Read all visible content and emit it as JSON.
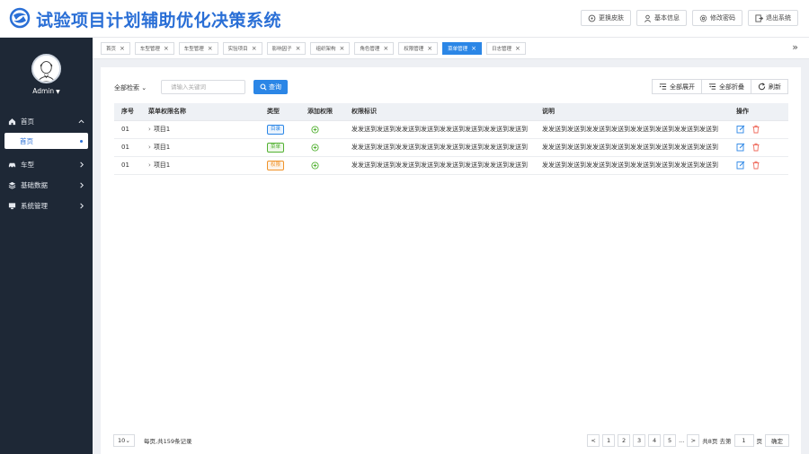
{
  "app": {
    "title": "试验项目计划辅助优化决策系统",
    "accent": "#2b86e6"
  },
  "header_buttons": [
    {
      "label": "更换皮肤",
      "icon": "skin-icon"
    },
    {
      "label": "基本信息",
      "icon": "user-icon"
    },
    {
      "label": "修改密码",
      "icon": "gear-icon"
    },
    {
      "label": "退出系统",
      "icon": "logout-icon"
    }
  ],
  "sidebar": {
    "user": "Admin",
    "items": [
      {
        "label": "首页",
        "icon": "home-icon"
      },
      {
        "label": "车型",
        "icon": "car-icon"
      },
      {
        "label": "基础数据",
        "icon": "data-icon"
      },
      {
        "label": "系统管理",
        "icon": "monitor-icon"
      }
    ],
    "sub_item": "首页"
  },
  "tabs": [
    {
      "label": "首页",
      "active": false
    },
    {
      "label": "车型管理",
      "active": false
    },
    {
      "label": "车型管理",
      "active": false
    },
    {
      "label": "实验项目",
      "active": false
    },
    {
      "label": "影响因子",
      "active": false
    },
    {
      "label": "组织架构",
      "active": false
    },
    {
      "label": "角色管理",
      "active": false
    },
    {
      "label": "权限管理",
      "active": false
    },
    {
      "label": "菜单管理",
      "active": true
    },
    {
      "label": "日志管理",
      "active": false
    }
  ],
  "toolbar": {
    "filter_label": "全部检索",
    "search_placeholder": "请输入关键词",
    "query_label": "查询",
    "expand_all": "全部展开",
    "collapse_all": "全部折叠",
    "refresh": "刷新"
  },
  "table": {
    "headers": [
      "序号",
      "菜单权限名称",
      "类型",
      "添加权限",
      "权限标识",
      "说明",
      "操作"
    ],
    "rows": [
      {
        "no": "01",
        "name": "项目1",
        "type": "目录",
        "type_color": "#2b86e6",
        "perm": "发发送到发送到发发送到发送到发发送到发送到发发送到发送到",
        "desc": "发发送到发送到发发送到发送到发发送到发送到发发送到发送到"
      },
      {
        "no": "01",
        "name": "项目1",
        "type": "菜单",
        "type_color": "#52b132",
        "perm": "发发送到发送到发发送到发送到发发送到发送到发发送到发送到",
        "desc": "发发送到发送到发发送到发送到发发送到发送到发发送到发送到"
      },
      {
        "no": "01",
        "name": "项目1",
        "type": "权限",
        "type_color": "#f0932a",
        "perm": "发发送到发送到发发送到发送到发发送到发送到发发送到发送到",
        "desc": "发发送到发送到发发送到发送到发发送到发送到发发送到发送到"
      }
    ]
  },
  "pagination": {
    "page_size": "10",
    "summary": "每页,共159条记录",
    "prev": "<",
    "pages": [
      "1",
      "2",
      "3",
      "4",
      "5"
    ],
    "ellipsis": "...",
    "next": ">",
    "total_pages": "共8页 去第",
    "jump_value": "1",
    "page_unit": "页",
    "go": "确定"
  }
}
